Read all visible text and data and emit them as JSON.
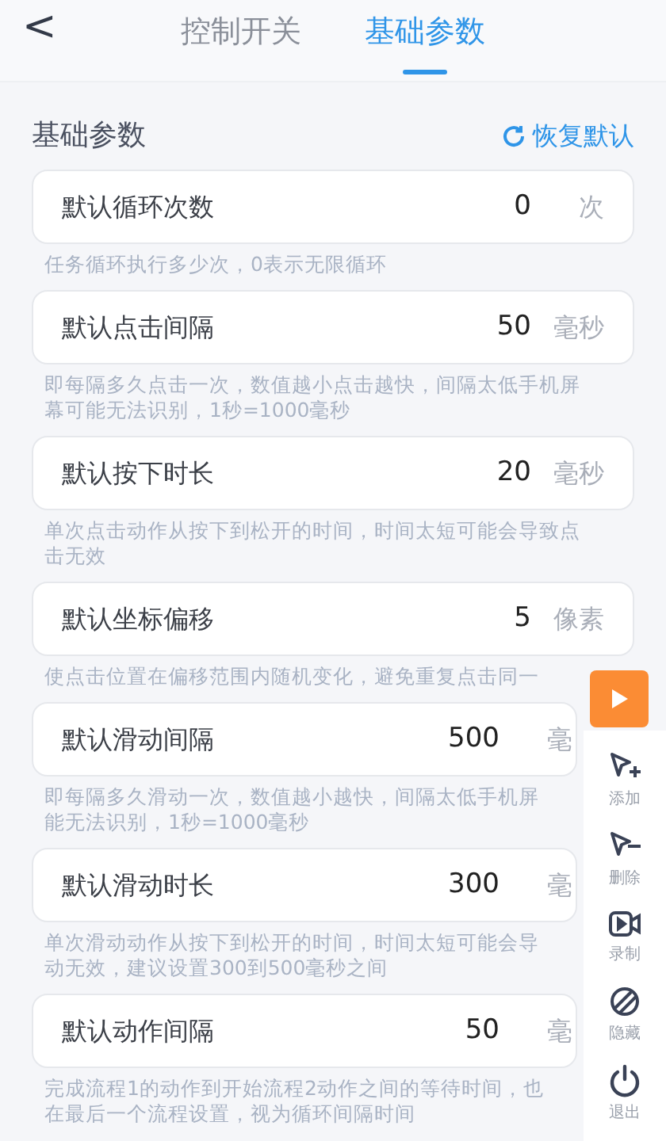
{
  "header": {
    "back": "<",
    "tabs": [
      {
        "label": "控制开关",
        "selected": false
      },
      {
        "label": "基础参数",
        "selected": true
      }
    ]
  },
  "section": {
    "title": "基础参数",
    "reset": "恢复默认"
  },
  "params": [
    {
      "label": "默认循环次数",
      "value": "0",
      "unit": "次",
      "hint": [
        "任务循环执行多少次，0表示无限循环"
      ]
    },
    {
      "label": "默认点击间隔",
      "value": "50",
      "unit": "毫秒",
      "hint": [
        "即每隔多久点击一次，数值越小点击越快，间隔太低手机屏",
        "幕可能无法识别，1秒=1000毫秒"
      ]
    },
    {
      "label": "默认按下时长",
      "value": "20",
      "unit": "毫秒",
      "hint": [
        "单次点击动作从按下到松开的时间，时间太短可能会导致点",
        "击无效"
      ]
    },
    {
      "label": "默认坐标偏移",
      "value": "5",
      "unit": "像素",
      "hint": [
        "使点击位置在偏移范围内随机变化，避免重复点击同一"
      ]
    },
    {
      "label": "默认滑动间隔",
      "value": "500",
      "unit": "毫",
      "hint": [
        "即每隔多久滑动一次，数值越小越快，间隔太低手机屏",
        "能无法识别，1秒=1000毫秒"
      ]
    },
    {
      "label": "默认滑动时长",
      "value": "300",
      "unit": "毫",
      "hint": [
        "单次滑动动作从按下到松开的时间，时间太短可能会导",
        "动无效，建议设置300到500毫秒之间"
      ]
    },
    {
      "label": "默认动作间隔",
      "value": "50",
      "unit": "毫",
      "hint": [
        "完成流程1的动作到开始流程2动作之间的等待时间，也",
        "在最后一个流程设置，视为循环间隔时间"
      ]
    }
  ],
  "toolbar": [
    {
      "kind": "add",
      "label": "添加"
    },
    {
      "kind": "delete",
      "label": "删除"
    },
    {
      "kind": "record",
      "label": "录制"
    },
    {
      "kind": "hide",
      "label": "隐藏"
    },
    {
      "kind": "exit",
      "label": "退出"
    }
  ]
}
